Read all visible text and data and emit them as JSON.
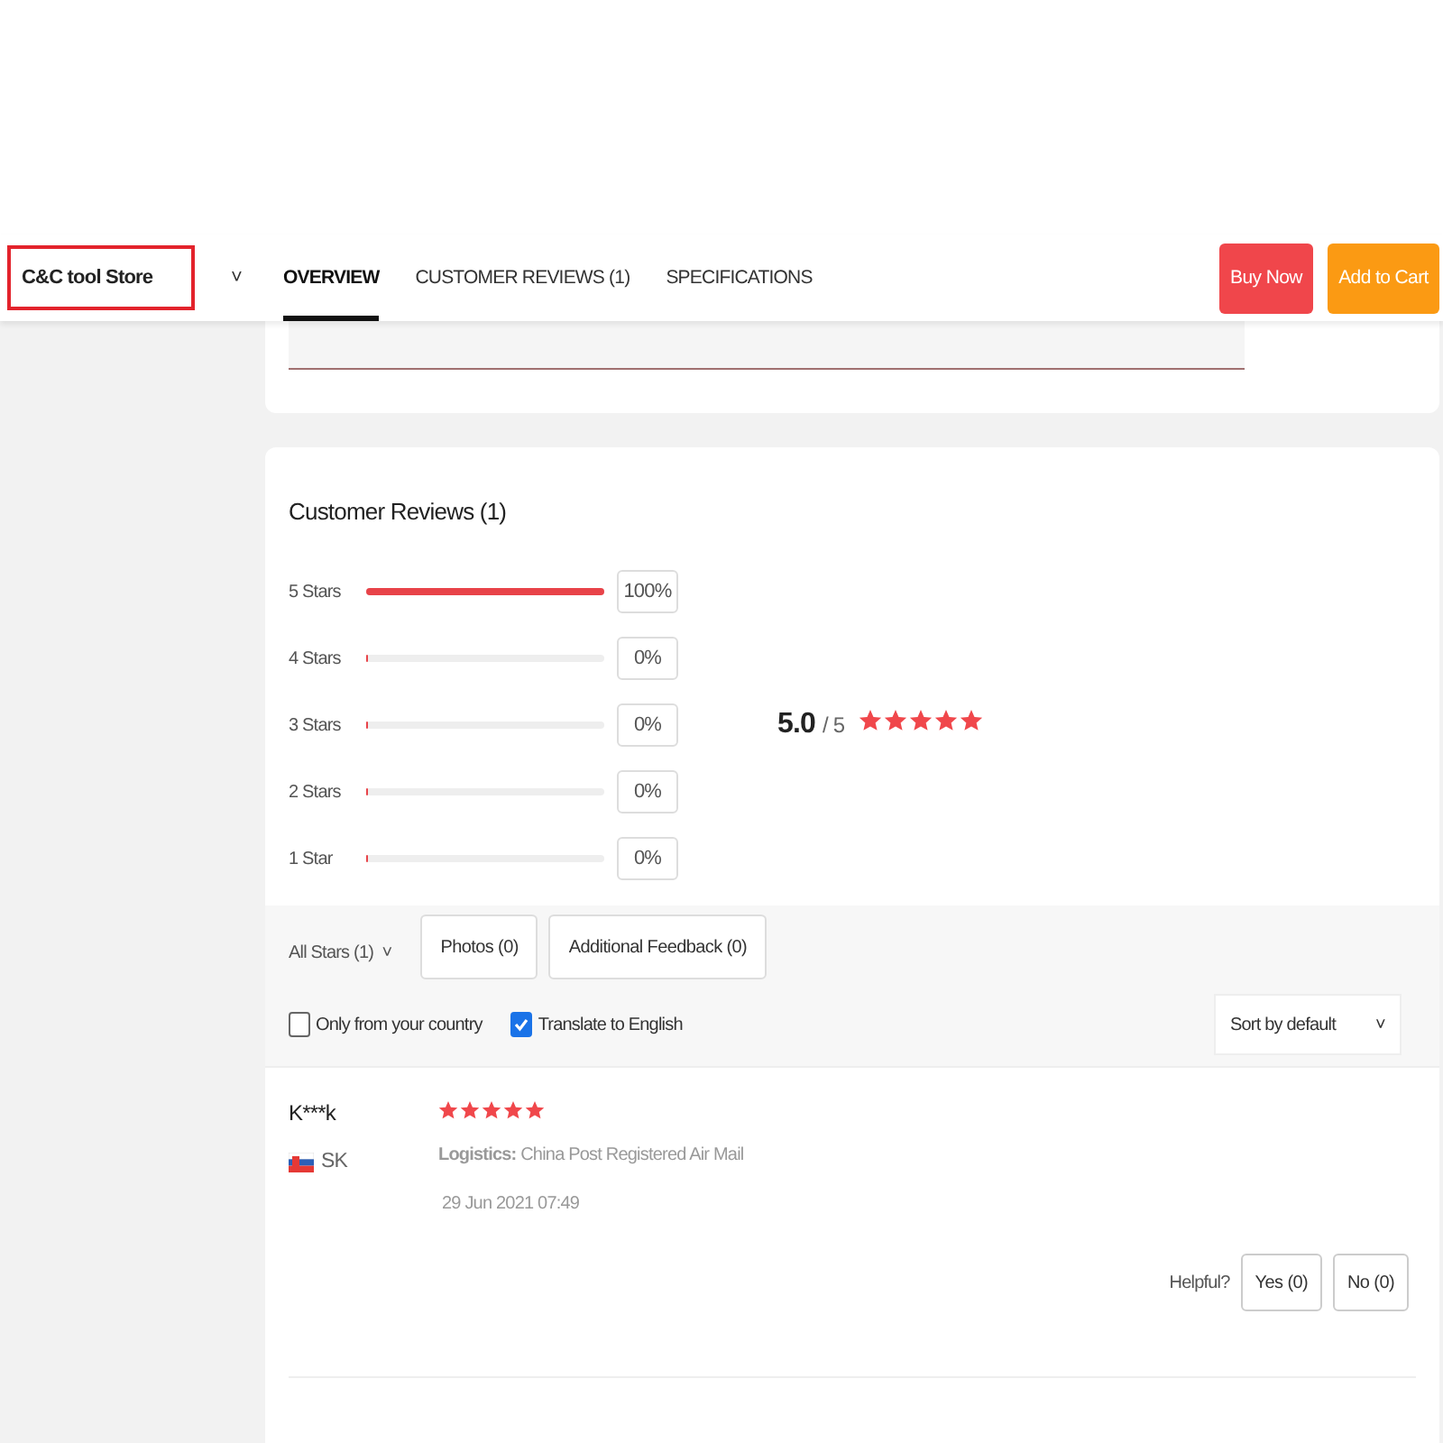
{
  "store": {
    "name": "C&C tool Store",
    "caret": "˅"
  },
  "tabs": [
    {
      "label": "OVERVIEW",
      "selected": true
    },
    {
      "label": "CUSTOMER REVIEWS (1)",
      "selected": false
    },
    {
      "label": "SPECIFICATIONS",
      "selected": false
    }
  ],
  "actions": [
    {
      "label": "Buy Now",
      "kind": "buy"
    },
    {
      "label": "Add to Cart",
      "kind": "cart"
    }
  ],
  "reviews": {
    "title": "Customer Reviews (1)",
    "distribution": [
      {
        "label": "5 Stars",
        "level": 1,
        "percent": "100%"
      },
      {
        "label": "4 Stars",
        "level": 0,
        "percent": "0%"
      },
      {
        "label": "3 Stars",
        "level": 0,
        "percent": "0%"
      },
      {
        "label": "2 Stars",
        "level": 0,
        "percent": "0%"
      },
      {
        "label": "1 Star",
        "level": 0,
        "percent": "0%"
      }
    ],
    "score": "5.0",
    "out_of": "/ 5",
    "stars": 5,
    "filters": [
      {
        "label": "All Stars (1)",
        "kind": "dropdown",
        "caret": "˅"
      },
      {
        "label": "Photos (0)",
        "kind": "button"
      },
      {
        "label": "Additional Feedback (0)",
        "kind": "button"
      }
    ],
    "options": [
      {
        "label": "Only from your country",
        "checked": false
      },
      {
        "label": "Translate to English",
        "checked": true
      }
    ],
    "sort": {
      "value": "Sort by default",
      "caret": "˅"
    },
    "items": [
      {
        "author": "K***k",
        "country": "SK",
        "stars": 5,
        "logistics": "**Logistics:** China Post Registered Air Mail",
        "date": "29 Jun 2021 07:49",
        "helpful_label": "Helpful?",
        "yes": "Yes (0)",
        "no": "No (0)"
      }
    ]
  }
}
